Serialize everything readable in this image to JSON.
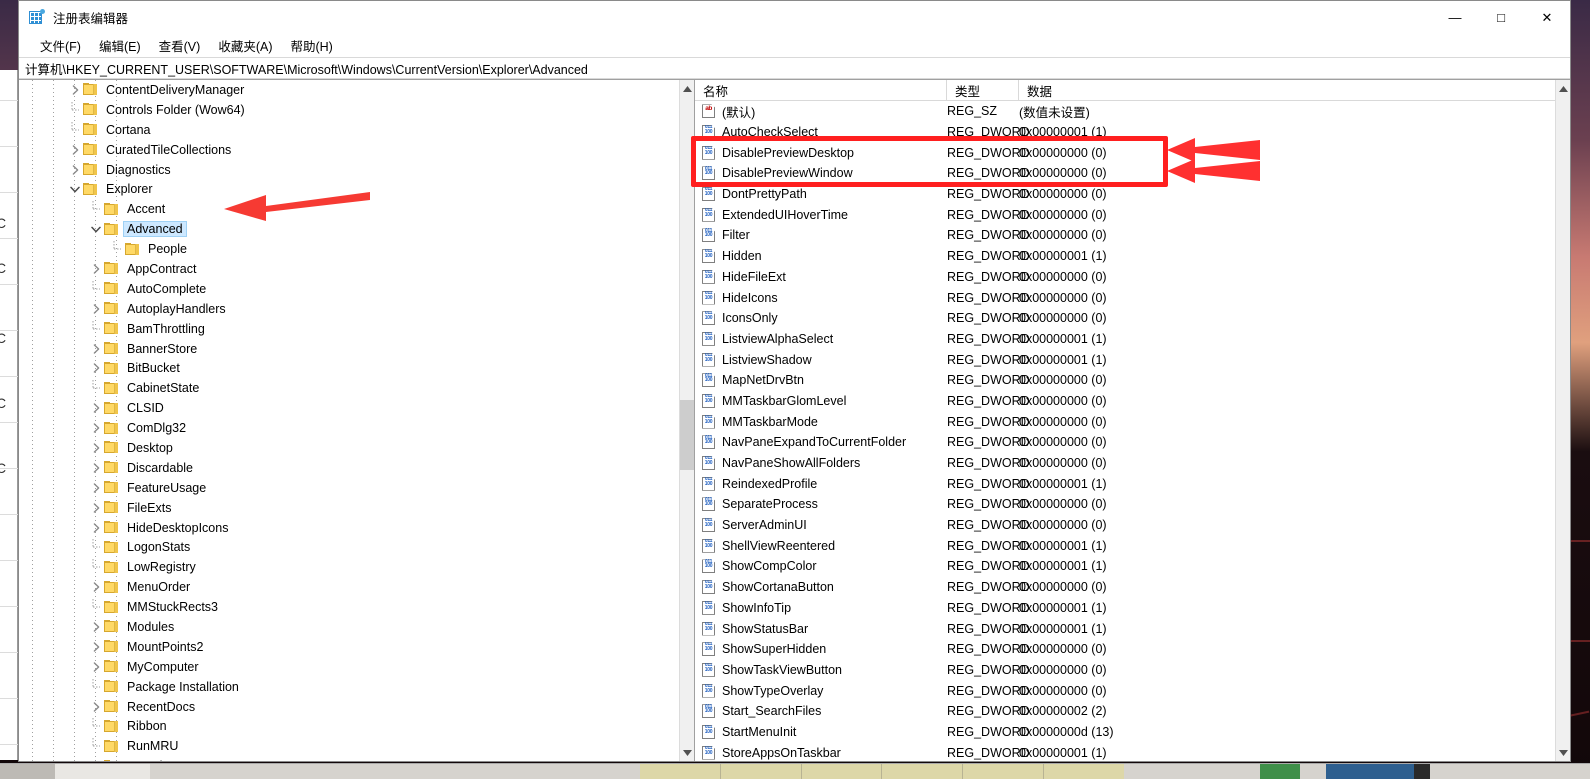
{
  "window": {
    "title": "注册表编辑器",
    "icon": "registry-editor-icon",
    "controls": {
      "minimize": "—",
      "maximize": "□",
      "close": "✕"
    }
  },
  "menu": {
    "items": [
      {
        "label": "文件(F)"
      },
      {
        "label": "编辑(E)"
      },
      {
        "label": "查看(V)"
      },
      {
        "label": "收藏夹(A)"
      },
      {
        "label": "帮助(H)"
      }
    ]
  },
  "address": {
    "path": "计算机\\HKEY_CURRENT_USER\\SOFTWARE\\Microsoft\\Windows\\CurrentVersion\\Explorer\\Advanced"
  },
  "tree": {
    "nodes": [
      {
        "label": "ContentDeliveryManager",
        "depth": 3,
        "twist": "collapsed",
        "selected": false
      },
      {
        "label": "Controls Folder (Wow64)",
        "depth": 3,
        "twist": "none",
        "selected": false
      },
      {
        "label": "Cortana",
        "depth": 3,
        "twist": "none",
        "selected": false
      },
      {
        "label": "CuratedTileCollections",
        "depth": 3,
        "twist": "collapsed",
        "selected": false
      },
      {
        "label": "Diagnostics",
        "depth": 3,
        "twist": "collapsed",
        "selected": false
      },
      {
        "label": "Explorer",
        "depth": 3,
        "twist": "expanded",
        "selected": false
      },
      {
        "label": "Accent",
        "depth": 4,
        "twist": "none",
        "selected": false
      },
      {
        "label": "Advanced",
        "depth": 4,
        "twist": "expanded",
        "selected": true
      },
      {
        "label": "People",
        "depth": 5,
        "twist": "none",
        "selected": false
      },
      {
        "label": "AppContract",
        "depth": 4,
        "twist": "collapsed",
        "selected": false
      },
      {
        "label": "AutoComplete",
        "depth": 4,
        "twist": "none",
        "selected": false
      },
      {
        "label": "AutoplayHandlers",
        "depth": 4,
        "twist": "collapsed",
        "selected": false
      },
      {
        "label": "BamThrottling",
        "depth": 4,
        "twist": "none",
        "selected": false
      },
      {
        "label": "BannerStore",
        "depth": 4,
        "twist": "collapsed",
        "selected": false
      },
      {
        "label": "BitBucket",
        "depth": 4,
        "twist": "collapsed",
        "selected": false
      },
      {
        "label": "CabinetState",
        "depth": 4,
        "twist": "none",
        "selected": false
      },
      {
        "label": "CLSID",
        "depth": 4,
        "twist": "collapsed",
        "selected": false
      },
      {
        "label": "ComDlg32",
        "depth": 4,
        "twist": "collapsed",
        "selected": false
      },
      {
        "label": "Desktop",
        "depth": 4,
        "twist": "collapsed",
        "selected": false
      },
      {
        "label": "Discardable",
        "depth": 4,
        "twist": "collapsed",
        "selected": false
      },
      {
        "label": "FeatureUsage",
        "depth": 4,
        "twist": "collapsed",
        "selected": false
      },
      {
        "label": "FileExts",
        "depth": 4,
        "twist": "collapsed",
        "selected": false
      },
      {
        "label": "HideDesktopIcons",
        "depth": 4,
        "twist": "collapsed",
        "selected": false
      },
      {
        "label": "LogonStats",
        "depth": 4,
        "twist": "none",
        "selected": false
      },
      {
        "label": "LowRegistry",
        "depth": 4,
        "twist": "none",
        "selected": false
      },
      {
        "label": "MenuOrder",
        "depth": 4,
        "twist": "collapsed",
        "selected": false
      },
      {
        "label": "MMStuckRects3",
        "depth": 4,
        "twist": "none",
        "selected": false
      },
      {
        "label": "Modules",
        "depth": 4,
        "twist": "collapsed",
        "selected": false
      },
      {
        "label": "MountPoints2",
        "depth": 4,
        "twist": "collapsed",
        "selected": false
      },
      {
        "label": "MyComputer",
        "depth": 4,
        "twist": "collapsed",
        "selected": false
      },
      {
        "label": "Package Installation",
        "depth": 4,
        "twist": "none",
        "selected": false
      },
      {
        "label": "RecentDocs",
        "depth": 4,
        "twist": "collapsed",
        "selected": false
      },
      {
        "label": "Ribbon",
        "depth": 4,
        "twist": "none",
        "selected": false
      },
      {
        "label": "RunMRU",
        "depth": 4,
        "twist": "none",
        "selected": false
      },
      {
        "label": "Search",
        "depth": 4,
        "twist": "collapsed",
        "selected": false
      }
    ]
  },
  "list": {
    "columns": {
      "name": "名称",
      "type": "类型",
      "data": "数据"
    },
    "rows": [
      {
        "name": "(默认)",
        "type": "REG_SZ",
        "data": "(数值未设置)",
        "icon": "string-value-icon"
      },
      {
        "name": "AutoCheckSelect",
        "type": "REG_DWORD",
        "data": "0x00000001 (1)",
        "icon": "dword-value-icon"
      },
      {
        "name": "DisablePreviewDesktop",
        "type": "REG_DWORD",
        "data": "0x00000000 (0)",
        "icon": "dword-value-icon"
      },
      {
        "name": "DisablePreviewWindow",
        "type": "REG_DWORD",
        "data": "0x00000000 (0)",
        "icon": "dword-value-icon"
      },
      {
        "name": "DontPrettyPath",
        "type": "REG_DWORD",
        "data": "0x00000000 (0)",
        "icon": "dword-value-icon"
      },
      {
        "name": "ExtendedUIHoverTime",
        "type": "REG_DWORD",
        "data": "0x00000000 (0)",
        "icon": "dword-value-icon"
      },
      {
        "name": "Filter",
        "type": "REG_DWORD",
        "data": "0x00000000 (0)",
        "icon": "dword-value-icon"
      },
      {
        "name": "Hidden",
        "type": "REG_DWORD",
        "data": "0x00000001 (1)",
        "icon": "dword-value-icon"
      },
      {
        "name": "HideFileExt",
        "type": "REG_DWORD",
        "data": "0x00000000 (0)",
        "icon": "dword-value-icon"
      },
      {
        "name": "HideIcons",
        "type": "REG_DWORD",
        "data": "0x00000000 (0)",
        "icon": "dword-value-icon"
      },
      {
        "name": "IconsOnly",
        "type": "REG_DWORD",
        "data": "0x00000000 (0)",
        "icon": "dword-value-icon"
      },
      {
        "name": "ListviewAlphaSelect",
        "type": "REG_DWORD",
        "data": "0x00000001 (1)",
        "icon": "dword-value-icon"
      },
      {
        "name": "ListviewShadow",
        "type": "REG_DWORD",
        "data": "0x00000001 (1)",
        "icon": "dword-value-icon"
      },
      {
        "name": "MapNetDrvBtn",
        "type": "REG_DWORD",
        "data": "0x00000000 (0)",
        "icon": "dword-value-icon"
      },
      {
        "name": "MMTaskbarGlomLevel",
        "type": "REG_DWORD",
        "data": "0x00000000 (0)",
        "icon": "dword-value-icon"
      },
      {
        "name": "MMTaskbarMode",
        "type": "REG_DWORD",
        "data": "0x00000000 (0)",
        "icon": "dword-value-icon"
      },
      {
        "name": "NavPaneExpandToCurrentFolder",
        "type": "REG_DWORD",
        "data": "0x00000000 (0)",
        "icon": "dword-value-icon"
      },
      {
        "name": "NavPaneShowAllFolders",
        "type": "REG_DWORD",
        "data": "0x00000000 (0)",
        "icon": "dword-value-icon"
      },
      {
        "name": "ReindexedProfile",
        "type": "REG_DWORD",
        "data": "0x00000001 (1)",
        "icon": "dword-value-icon"
      },
      {
        "name": "SeparateProcess",
        "type": "REG_DWORD",
        "data": "0x00000000 (0)",
        "icon": "dword-value-icon"
      },
      {
        "name": "ServerAdminUI",
        "type": "REG_DWORD",
        "data": "0x00000000 (0)",
        "icon": "dword-value-icon"
      },
      {
        "name": "ShellViewReentered",
        "type": "REG_DWORD",
        "data": "0x00000001 (1)",
        "icon": "dword-value-icon"
      },
      {
        "name": "ShowCompColor",
        "type": "REG_DWORD",
        "data": "0x00000001 (1)",
        "icon": "dword-value-icon"
      },
      {
        "name": "ShowCortanaButton",
        "type": "REG_DWORD",
        "data": "0x00000000 (0)",
        "icon": "dword-value-icon"
      },
      {
        "name": "ShowInfoTip",
        "type": "REG_DWORD",
        "data": "0x00000001 (1)",
        "icon": "dword-value-icon"
      },
      {
        "name": "ShowStatusBar",
        "type": "REG_DWORD",
        "data": "0x00000001 (1)",
        "icon": "dword-value-icon"
      },
      {
        "name": "ShowSuperHidden",
        "type": "REG_DWORD",
        "data": "0x00000000 (0)",
        "icon": "dword-value-icon"
      },
      {
        "name": "ShowTaskViewButton",
        "type": "REG_DWORD",
        "data": "0x00000000 (0)",
        "icon": "dword-value-icon"
      },
      {
        "name": "ShowTypeOverlay",
        "type": "REG_DWORD",
        "data": "0x00000000 (0)",
        "icon": "dword-value-icon"
      },
      {
        "name": "Start_SearchFiles",
        "type": "REG_DWORD",
        "data": "0x00000002 (2)",
        "icon": "dword-value-icon"
      },
      {
        "name": "StartMenuInit",
        "type": "REG_DWORD",
        "data": "0x0000000d (13)",
        "icon": "dword-value-icon"
      },
      {
        "name": "StoreAppsOnTaskbar",
        "type": "REG_DWORD",
        "data": "0x00000001 (1)",
        "icon": "dword-value-icon"
      }
    ]
  },
  "annotations": {
    "highlight_color": "#ff1f1f",
    "arrow_tree_target": "Advanced",
    "arrow_list_targets": [
      "DisablePreviewDesktop",
      "DisablePreviewWindow"
    ],
    "box_targets": [
      "DisablePreviewDesktop",
      "DisablePreviewWindow"
    ]
  },
  "background": {
    "left_sliver_glyphs": [
      "C",
      "C",
      "C",
      "C",
      "C"
    ]
  }
}
